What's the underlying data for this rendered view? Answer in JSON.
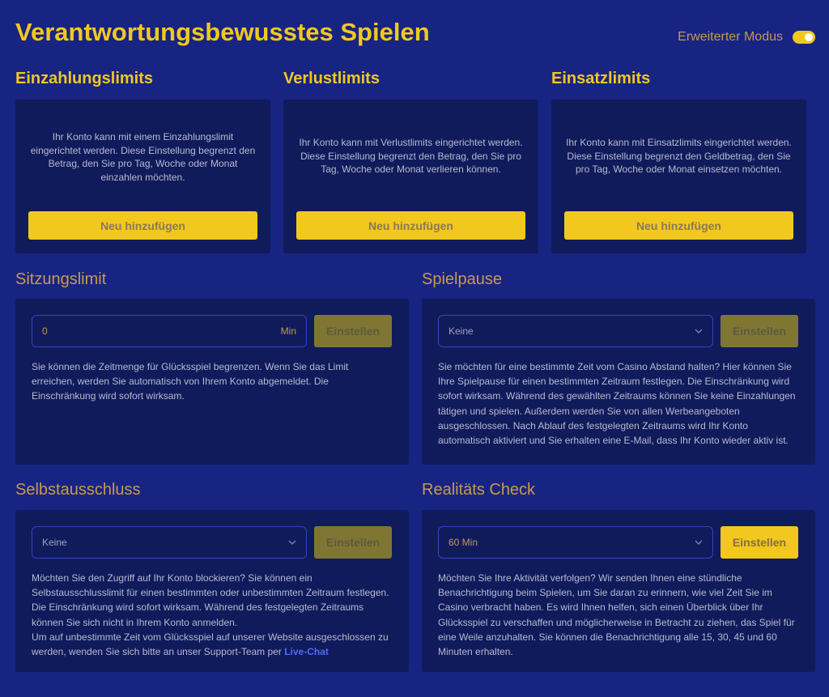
{
  "header": {
    "title": "Verantwortungsbewusstes Spielen",
    "mode_label": "Erweiterter Modus",
    "mode_on": true
  },
  "colors": {
    "background": "#172482",
    "card": "#101b5c",
    "accent_yellow": "#f2c81e",
    "accent_orange": "#c8994f",
    "link_blue": "#4d6cf0"
  },
  "deposit": {
    "title": "Einzahlungslimits",
    "description": "Ihr Konto kann mit einem Einzahlungslimit eingerichtet werden. Diese Einstellung begrenzt den Betrag, den Sie pro Tag, Woche oder Monat einzahlen möchten.",
    "button": "Neu hinzufügen"
  },
  "loss": {
    "title": "Verlustlimits",
    "description": "Ihr Konto kann mit Verlustlimits eingerichtet werden. Diese Einstellung begrenzt den Betrag, den Sie pro Tag, Woche oder Monat verlieren können.",
    "button": "Neu hinzufügen"
  },
  "wager": {
    "title": "Einsatzlimits",
    "description": "Ihr Konto kann mit Einsatzlimits eingerichtet werden. Diese Einstellung begrenzt den Geldbetrag, den Sie pro Tag, Woche oder Monat einsetzen möchten.",
    "button": "Neu hinzufügen"
  },
  "session": {
    "title": "Sitzungslimit",
    "input_value": "0",
    "unit": "Min",
    "button": "Einstellen",
    "description": "Sie können die Zeitmenge für Glücksspiel begrenzen. Wenn Sie das Limit erreichen, werden Sie automatisch von Ihrem Konto abgemeldet. Die Einschränkung wird sofort wirksam."
  },
  "pause": {
    "title": "Spielpause",
    "selected": "Keine",
    "button": "Einstellen",
    "description": "Sie möchten für eine bestimmte Zeit vom Casino Abstand halten? Hier können Sie Ihre Spielpause für einen bestimmten Zeitraum festlegen. Die Einschränkung wird sofort wirksam. Während des gewählten Zeitraums können Sie keine Einzahlungen tätigen und spielen. Außerdem werden Sie von allen Werbeangeboten ausgeschlossen. Nach Ablauf des festgelegten Zeitraums wird Ihr Konto automatisch aktiviert und Sie erhalten eine E-Mail, dass Ihr Konto wieder aktiv ist."
  },
  "exclusion": {
    "title": "Selbstausschluss",
    "selected": "Keine",
    "button": "Einstellen",
    "description": "Möchten Sie den Zugriff auf Ihr Konto blockieren? Sie können ein Selbstausschlusslimit für einen bestimmten oder unbestimmten Zeitraum festlegen. Die Einschränkung wird sofort wirksam. Während des festgelegten Zeitraums können Sie sich nicht in Ihrem Konto anmelden.",
    "description_2": "Um auf unbestimmte Zeit vom Glücksspiel auf unserer Website ausgeschlossen zu werden, wenden Sie sich bitte an unser Support-Team per",
    "link": "Live-Chat"
  },
  "reality": {
    "title": "Realitäts Check",
    "selected": "60 Min",
    "button": "Einstellen",
    "description": "Möchten Sie Ihre Aktivität verfolgen? Wir senden Ihnen eine stündliche Benachrichtigung beim Spielen, um Sie daran zu erinnern, wie viel Zeit Sie im Casino verbracht haben. Es wird Ihnen helfen, sich einen Überblick über Ihr Glücksspiel zu verschaffen und möglicherweise in Betracht zu ziehen, das Spiel für eine Weile anzuhalten. Sie können die Benachrichtigung alle 15, 30, 45 und 60 Minuten erhalten."
  }
}
